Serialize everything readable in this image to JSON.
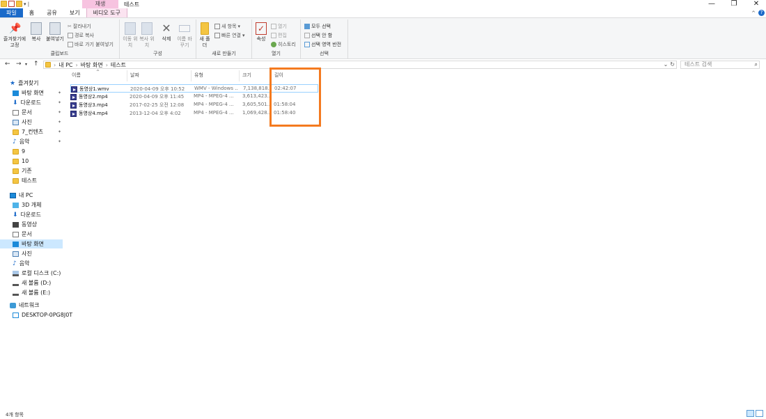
{
  "titlebar": {
    "context_tab": "재생",
    "title": "테스트",
    "min": "—",
    "max": "❐",
    "close": "✕"
  },
  "tabs": [
    "파일",
    "홈",
    "공유",
    "보기",
    "비디오 도구"
  ],
  "ribbon": {
    "clipboard": {
      "pin": "즐겨찾기에 고정",
      "copy": "복사",
      "paste": "붙여넣기",
      "cut": "잘라내기",
      "copy_path": "경로 복사",
      "paste_shortcut": "바로 가기 붙여넣기",
      "label": "클립보드"
    },
    "organize": {
      "move": "이동 위치",
      "copy_to": "복사 위치",
      "delete": "삭제",
      "rename": "이름 바꾸기",
      "label": "구성"
    },
    "new": {
      "new_folder": "새 폴더",
      "new_item": "새 항목",
      "easy_access": "빠른 연결",
      "label": "새로 만들기"
    },
    "open": {
      "properties": "속성",
      "open": "열기",
      "edit": "편집",
      "history": "히스토리",
      "label": "열기"
    },
    "select": {
      "select_all": "모두 선택",
      "select_none": "선택 안 함",
      "invert": "선택 영역 반전",
      "label": "선택"
    }
  },
  "address": {
    "crumbs": [
      "내 PC",
      "바탕 화면",
      "테스트"
    ],
    "search_placeholder": "테스트 검색"
  },
  "sidebar": {
    "items": [
      {
        "label": "즐겨찾기",
        "icon": "star-icon"
      },
      {
        "label": "바탕 화면",
        "icon": "desktop-icon"
      },
      {
        "label": "다운로드",
        "icon": "download-icon"
      },
      {
        "label": "문서",
        "icon": "document-icon"
      },
      {
        "label": "사진",
        "icon": "picture-icon"
      },
      {
        "label": "7_컨텐츠",
        "icon": "folder-icon"
      },
      {
        "label": "음악",
        "icon": "music-icon"
      },
      {
        "label": "9",
        "icon": "folder-icon"
      },
      {
        "label": "10",
        "icon": "folder-icon"
      },
      {
        "label": "기존",
        "icon": "folder-icon"
      },
      {
        "label": "테스트",
        "icon": "folder-icon"
      },
      {
        "label": "내 PC",
        "icon": "pc-icon"
      },
      {
        "label": "3D 개체",
        "icon": "cube-icon"
      },
      {
        "label": "다운로드",
        "icon": "download-icon"
      },
      {
        "label": "동영상",
        "icon": "video-icon"
      },
      {
        "label": "문서",
        "icon": "document-icon"
      },
      {
        "label": "바탕 화면",
        "icon": "desktop-icon"
      },
      {
        "label": "사진",
        "icon": "picture-icon"
      },
      {
        "label": "음악",
        "icon": "music-icon"
      },
      {
        "label": "로컬 디스크 (C:)",
        "icon": "drive-icon"
      },
      {
        "label": "새 볼륨 (D:)",
        "icon": "drive-icon"
      },
      {
        "label": "새 볼륨 (E:)",
        "icon": "drive-icon"
      },
      {
        "label": "네트워크",
        "icon": "network-icon"
      },
      {
        "label": "DESKTOP-0PG8J0T",
        "icon": "computer-icon"
      }
    ]
  },
  "columns": {
    "name": "이름",
    "date": "날짜",
    "type": "유형",
    "size": "크기",
    "length": "길이"
  },
  "files": [
    {
      "name": "동영상1.wmv",
      "date": "2020-04-09 오후 10:52",
      "type": "WMV - Windows ...",
      "size": "7,138,818...",
      "length": "02:42:07"
    },
    {
      "name": "동영상2.mp4",
      "date": "2020-04-09 오후 11:45",
      "type": "MP4 - MPEG-4 ...",
      "size": "3,613,423...",
      "length": ""
    },
    {
      "name": "동영상3.mp4",
      "date": "2017-02-25 오전 12:08",
      "type": "MP4 - MPEG-4 ...",
      "size": "3,605,501...",
      "length": "01:58:04"
    },
    {
      "name": "동영상4.mp4",
      "date": "2013-12-04 오후 4:02",
      "type": "MP4 - MPEG-4 ...",
      "size": "1,069,428...",
      "length": "01:58:40"
    }
  ],
  "status": {
    "count": "4개 항목"
  },
  "colors": {
    "accent": "#1b6ac9",
    "highlight": "#f47a1f",
    "selection": "#cce8ff"
  }
}
